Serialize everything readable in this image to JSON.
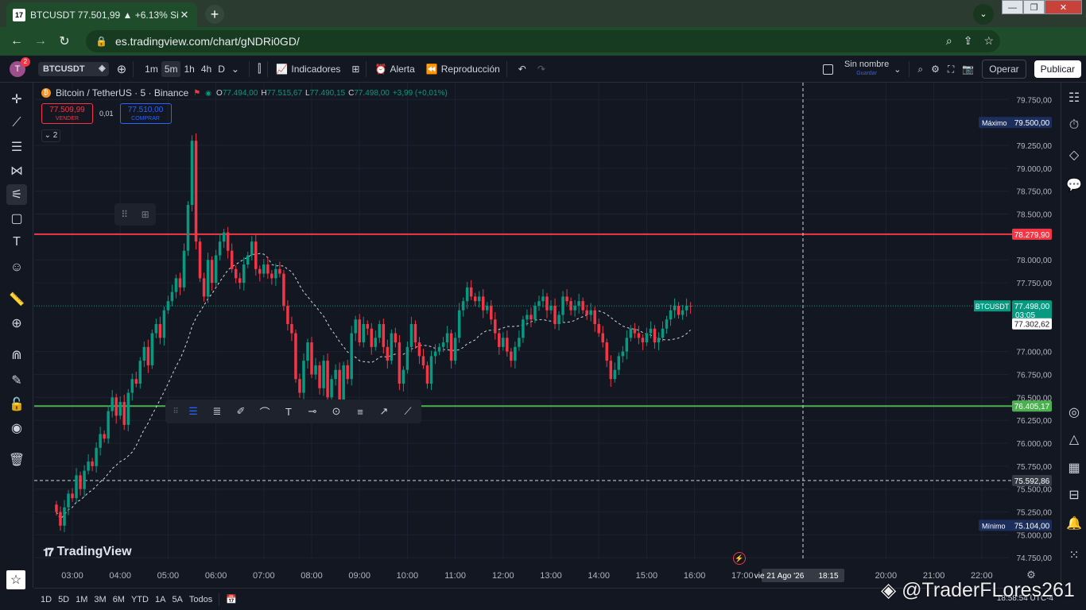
{
  "browser": {
    "tab_title": "BTCUSDT 77.501,99 ▲ +6.13% Si",
    "tab_favicon": "17",
    "url": "es.tradingview.com/chart/gNDRi0GD/"
  },
  "toolbar": {
    "avatar_letter": "T",
    "notifications": "2",
    "symbol": "BTCUSDT",
    "timeframes": [
      "1m",
      "5m",
      "1h",
      "4h",
      "D"
    ],
    "active_timeframe": "5m",
    "indicators_label": "Indicadores",
    "alert_label": "Alerta",
    "replay_label": "Reproducción",
    "layout_name": "Sin nombre",
    "layout_sub": "Guardar",
    "operar_label": "Operar",
    "publicar_label": "Publicar"
  },
  "legend": {
    "name": "Bitcoin / TetherUS · 5 · Binance",
    "open_label": "O",
    "open": "77.494,00",
    "high_label": "H",
    "high": "77.515,67",
    "low_label": "L",
    "low": "77.490,15",
    "close_label": "C",
    "close": "77.498,00",
    "change": "+3,99 (+0,01%)",
    "sell_price": "77.509,99",
    "sell_label": "VENDER",
    "spread": "0,01",
    "buy_price": "77.510,00",
    "buy_label": "COMPRAR",
    "collapsed_count": "2"
  },
  "chart_data": {
    "type": "candlestick",
    "colors": {
      "up": "#089981",
      "down": "#f23645",
      "background": "#131722",
      "grid": "#1e2230",
      "ma": "#d1d4dc"
    },
    "x_ticks": [
      "03:00",
      "04:00",
      "05:00",
      "06:00",
      "07:00",
      "08:00",
      "09:00",
      "10:00",
      "11:00",
      "12:00",
      "13:00",
      "14:00",
      "15:00",
      "16:00",
      "17:00",
      "20:00",
      "21:00",
      "22:00"
    ],
    "x_cursor_label": "vie 21 Ago '26",
    "x_cursor_time": "18:15",
    "y_ticks": [
      "79.750,00",
      "79.250,00",
      "79.000,00",
      "78.750,00",
      "78.500,00",
      "78.000,00",
      "77.750,00",
      "77.000,00",
      "76.750,00",
      "76.500,00",
      "76.250,00",
      "76.000,00",
      "75.750,00",
      "75.500,00",
      "75.250,00",
      "75.000,00",
      "74.750,00"
    ],
    "ylim": [
      74700,
      79900
    ],
    "horizontal_lines": [
      {
        "price": 78279.9,
        "label": "78.279,90",
        "color": "#f23645"
      },
      {
        "price": 76405.17,
        "label": "76.405,17",
        "color": "#4caf50"
      }
    ],
    "cursor_price": {
      "price": 75592.86,
      "label": "75.592,86"
    },
    "max_marker": {
      "text": "Máximo",
      "price": 79500,
      "label": "79.500,00"
    },
    "min_marker": {
      "text": "Mínimo",
      "price": 75104,
      "label": "75.104,00"
    },
    "last_price": {
      "symbol": "BTCUSDT",
      "price": 77498,
      "label": "77.498,00",
      "countdown": "03:05"
    },
    "ma_value": {
      "price": 77302.62,
      "label": "77.302,62"
    },
    "start_hour": 2.667,
    "bar_minutes": 5,
    "closes": [
      75250,
      75100,
      75300,
      75450,
      75400,
      75650,
      75500,
      75700,
      75800,
      75750,
      75950,
      76100,
      76050,
      76350,
      76500,
      76300,
      76450,
      76200,
      76550,
      76700,
      76650,
      76900,
      77050,
      76850,
      77200,
      77300,
      77150,
      77450,
      77550,
      77650,
      77800,
      77700,
      78100,
      78600,
      79300,
      78200,
      77800,
      77600,
      78000,
      77750,
      78050,
      78200,
      78300,
      78100,
      77900,
      77800,
      77750,
      77950,
      78050,
      78200,
      77900,
      77850,
      77950,
      77850,
      77800,
      77900,
      77850,
      77500,
      77300,
      77200,
      76700,
      76550,
      76900,
      77100,
      76750,
      76850,
      76600,
      76900,
      76500,
      76700,
      76800,
      76450,
      76850,
      76700,
      77200,
      77350,
      77100,
      77300,
      77250,
      77050,
      77150,
      77300,
      77050,
      76900,
      77200,
      77100,
      76650,
      76800,
      77050,
      77300,
      77100,
      76950,
      76850,
      76650,
      76950,
      77000,
      77050,
      77100,
      77200,
      76900,
      77150,
      77450,
      77550,
      77700,
      77600,
      77550,
      77600,
      77450,
      77500,
      77350,
      77200,
      77050,
      77150,
      77000,
      76900,
      77050,
      77150,
      77350,
      77400,
      77350,
      77500,
      77550,
      77600,
      77450,
      77500,
      77300,
      77400,
      77600,
      77550,
      77450,
      77500,
      77550,
      77450,
      77400,
      77450,
      77300,
      77200,
      77100,
      76900,
      76700,
      76800,
      76950,
      77000,
      77150,
      77250,
      77200,
      77150,
      77100,
      77200,
      77250,
      77100,
      77150,
      77250,
      77350,
      77450,
      77500,
      77400,
      77450,
      77500,
      77498
    ]
  },
  "drawbar": {
    "grip": "⠿"
  },
  "bottombar": {
    "ranges": [
      "1D",
      "5D",
      "1M",
      "3M",
      "6M",
      "YTD",
      "1A",
      "5A",
      "Todos"
    ],
    "clock": "18:58:54 UTC-4"
  },
  "watermark": "@TraderFLores261",
  "logo": "TradingView"
}
